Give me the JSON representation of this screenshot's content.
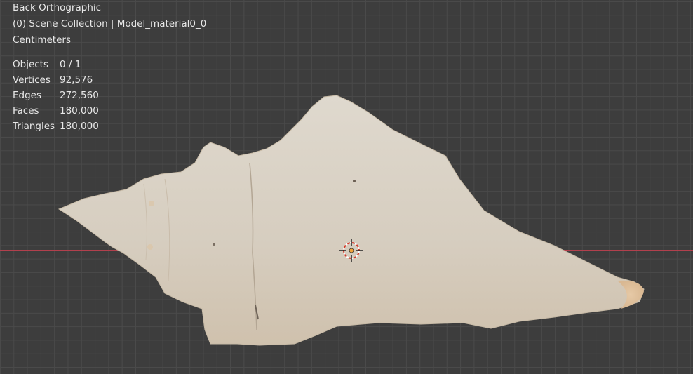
{
  "viewport": {
    "view_name": "Back Orthographic",
    "collection_info": "(0) Scene Collection | Model_material0_0",
    "units": "Centimeters"
  },
  "stats": [
    {
      "label": "Objects",
      "value": "0 / 1"
    },
    {
      "label": "Vertices",
      "value": "92,576"
    },
    {
      "label": "Edges",
      "value": "272,560"
    },
    {
      "label": "Faces",
      "value": "180,000"
    },
    {
      "label": "Triangles",
      "value": "180,000"
    }
  ],
  "colors": {
    "background": "#3d3d3d",
    "grid": "#4a4a4a",
    "x_axis": "#b2404d",
    "y_axis": "#3f6fa8",
    "overlay_text": "#e8e8e8",
    "model": "#d9d1c4"
  }
}
